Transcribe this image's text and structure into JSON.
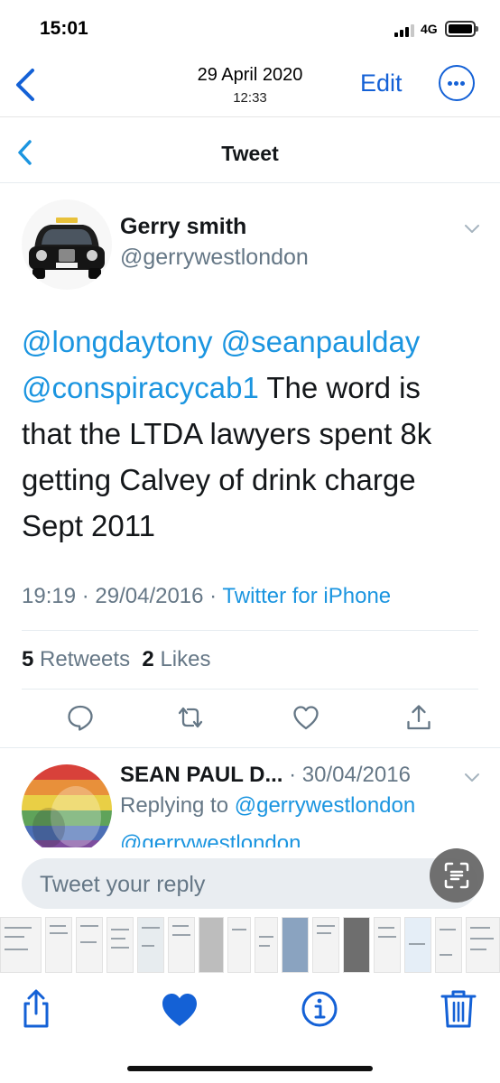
{
  "status_bar": {
    "time": "15:01",
    "network": "4G",
    "battery_level": 0.85,
    "signal_bars": 4,
    "signal_bars_active": 3
  },
  "photos_header": {
    "date": "29 April 2020",
    "time": "12:33",
    "edit_label": "Edit",
    "back_icon": "chevron-left-icon",
    "more_icon": "ellipsis-circle-icon"
  },
  "tweet_screen": {
    "title": "Tweet",
    "author": {
      "name": "Gerry smith",
      "handle": "@gerrywestlondon",
      "avatar_desc": "black-taxi-avatar"
    },
    "text": {
      "mention_1": "@longdaytony",
      "mention_2": "@seanpaulday",
      "mention_3": "@conspiracycab1",
      "line_2_rest": " The word is",
      "line_3": "that the LTDA lawyers spent 8k",
      "line_4": "getting Calvey of drink charge",
      "line_5": "Sept 2011"
    },
    "meta": {
      "timestamp": "19:19 · 29/04/2016 · ",
      "source": "Twitter for iPhone"
    },
    "stats": {
      "retweets_count": "5",
      "retweets_label": " Retweets",
      "likes_count": "2",
      "likes_label": " Likes"
    },
    "actions": [
      "reply-icon",
      "retweet-icon",
      "like-icon",
      "share-icon"
    ],
    "reply": {
      "name": "SEAN PAUL D...",
      "date": " · 30/04/2016",
      "replying_prefix": "Replying to ",
      "replying_to": "@gerrywestlondon",
      "cut_line": "@gerrywestlondon"
    },
    "compose_placeholder": "Tweet your reply"
  },
  "toolbar": {
    "icons": [
      "share-icon",
      "heart-icon",
      "info-icon",
      "trash-icon"
    ]
  },
  "colors": {
    "ios_blue": "#1461d6",
    "twitter_blue": "#1b95e0",
    "twitter_gray": "#657786",
    "text": "#14171a"
  }
}
